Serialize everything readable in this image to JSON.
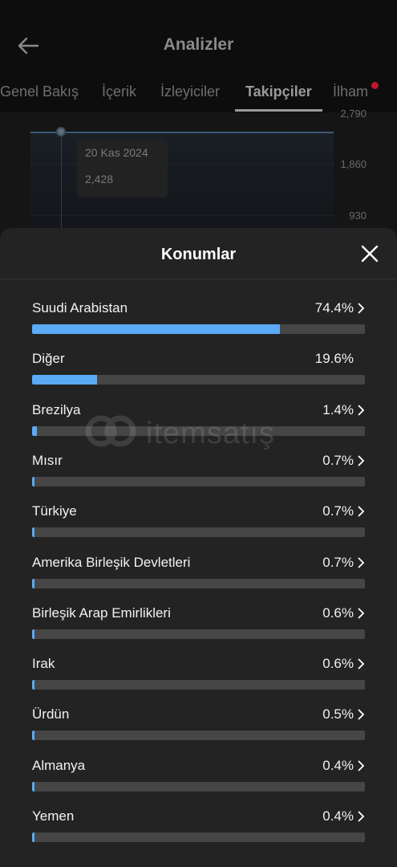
{
  "header": {
    "title": "Analizler",
    "tabs": [
      {
        "label": "Genel Bakış"
      },
      {
        "label": "İçerik"
      },
      {
        "label": "İzleyiciler"
      },
      {
        "label": "Takipçiler"
      },
      {
        "label": "İlham"
      }
    ],
    "active_tab": "Takipçiler"
  },
  "chart": {
    "y_ticks": [
      "2,790",
      "1,860",
      "930"
    ],
    "tooltip_date": "20 Kas 2024",
    "tooltip_value": "2,428"
  },
  "sheet": {
    "title": "Konumlar",
    "locations": [
      {
        "name": "Suudi Arabistan",
        "percent": "74.4%",
        "fraction": 0.744,
        "has_chevron": true
      },
      {
        "name": "Diğer",
        "percent": "19.6%",
        "fraction": 0.196,
        "has_chevron": false
      },
      {
        "name": "Brezilya",
        "percent": "1.4%",
        "fraction": 0.014,
        "has_chevron": true
      },
      {
        "name": "Mısır",
        "percent": "0.7%",
        "fraction": 0.007,
        "has_chevron": true
      },
      {
        "name": "Türkiye",
        "percent": "0.7%",
        "fraction": 0.007,
        "has_chevron": true
      },
      {
        "name": "Amerika Birleşik Devletleri",
        "percent": "0.7%",
        "fraction": 0.007,
        "has_chevron": true
      },
      {
        "name": "Birleşik Arap Emirlikleri",
        "percent": "0.6%",
        "fraction": 0.006,
        "has_chevron": true
      },
      {
        "name": "Irak",
        "percent": "0.6%",
        "fraction": 0.006,
        "has_chevron": true
      },
      {
        "name": "Ürdün",
        "percent": "0.5%",
        "fraction": 0.005,
        "has_chevron": true
      },
      {
        "name": "Almanya",
        "percent": "0.4%",
        "fraction": 0.004,
        "has_chevron": true
      },
      {
        "name": "Yemen",
        "percent": "0.4%",
        "fraction": 0.004,
        "has_chevron": true
      }
    ]
  },
  "watermark": {
    "text": "itemsatış"
  },
  "colors": {
    "bar_fill": "#5aaaf5",
    "bar_track": "#464646",
    "sheet_bg": "#232323",
    "notification_dot": "#c0152f"
  }
}
